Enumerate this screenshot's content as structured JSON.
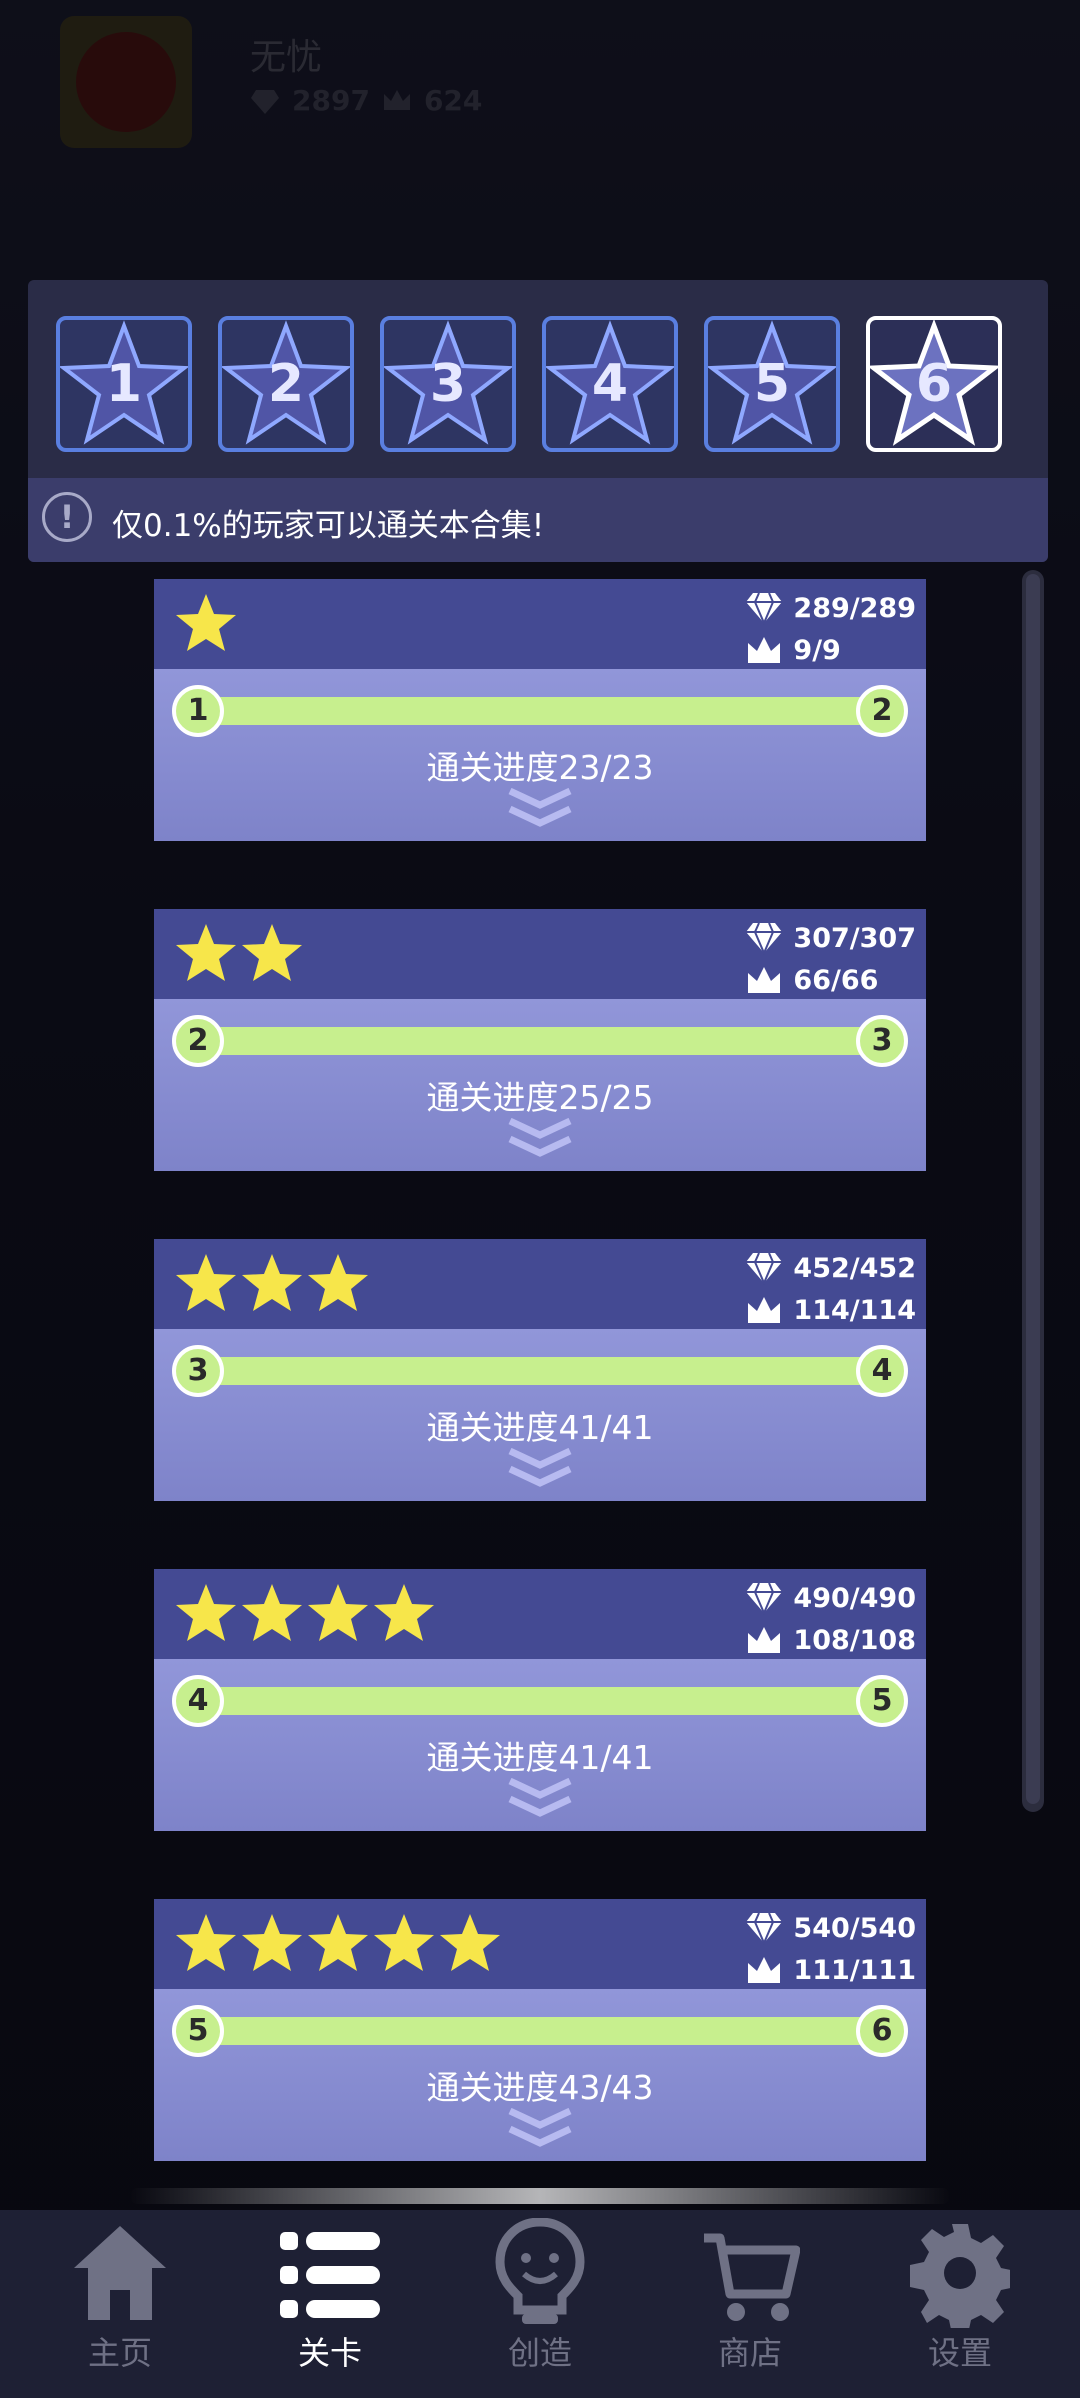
{
  "header": {
    "username": "无忧",
    "diamonds": "2897",
    "crowns": "624"
  },
  "tabs": [
    "1",
    "2",
    "3",
    "4",
    "5",
    "6"
  ],
  "active_tab": "6",
  "notice": "仅0.1%的玩家可以通关本合集!",
  "cards": [
    {
      "stars": 1,
      "gems": "289/289",
      "crowns": "9/9",
      "from": "1",
      "to": "2",
      "progress": "通关进度23/23"
    },
    {
      "stars": 2,
      "gems": "307/307",
      "crowns": "66/66",
      "from": "2",
      "to": "3",
      "progress": "通关进度25/25"
    },
    {
      "stars": 3,
      "gems": "452/452",
      "crowns": "114/114",
      "from": "3",
      "to": "4",
      "progress": "通关进度41/41"
    },
    {
      "stars": 4,
      "gems": "490/490",
      "crowns": "108/108",
      "from": "4",
      "to": "5",
      "progress": "通关进度41/41"
    },
    {
      "stars": 5,
      "gems": "540/540",
      "crowns": "111/111",
      "from": "5",
      "to": "6",
      "progress": "通关进度43/43"
    }
  ],
  "nav": [
    {
      "label": "主页",
      "icon": "home-icon"
    },
    {
      "label": "关卡",
      "icon": "list-icon"
    },
    {
      "label": "创造",
      "icon": "lightbulb-icon"
    },
    {
      "label": "商店",
      "icon": "cart-icon"
    },
    {
      "label": "设置",
      "icon": "gear-icon"
    }
  ],
  "active_nav": "关卡",
  "colors": {
    "accent_green": "#c7ef8e",
    "star_yellow": "#f7e64a",
    "card_top": "#444a93",
    "tab_border": "#5a7fe0"
  }
}
